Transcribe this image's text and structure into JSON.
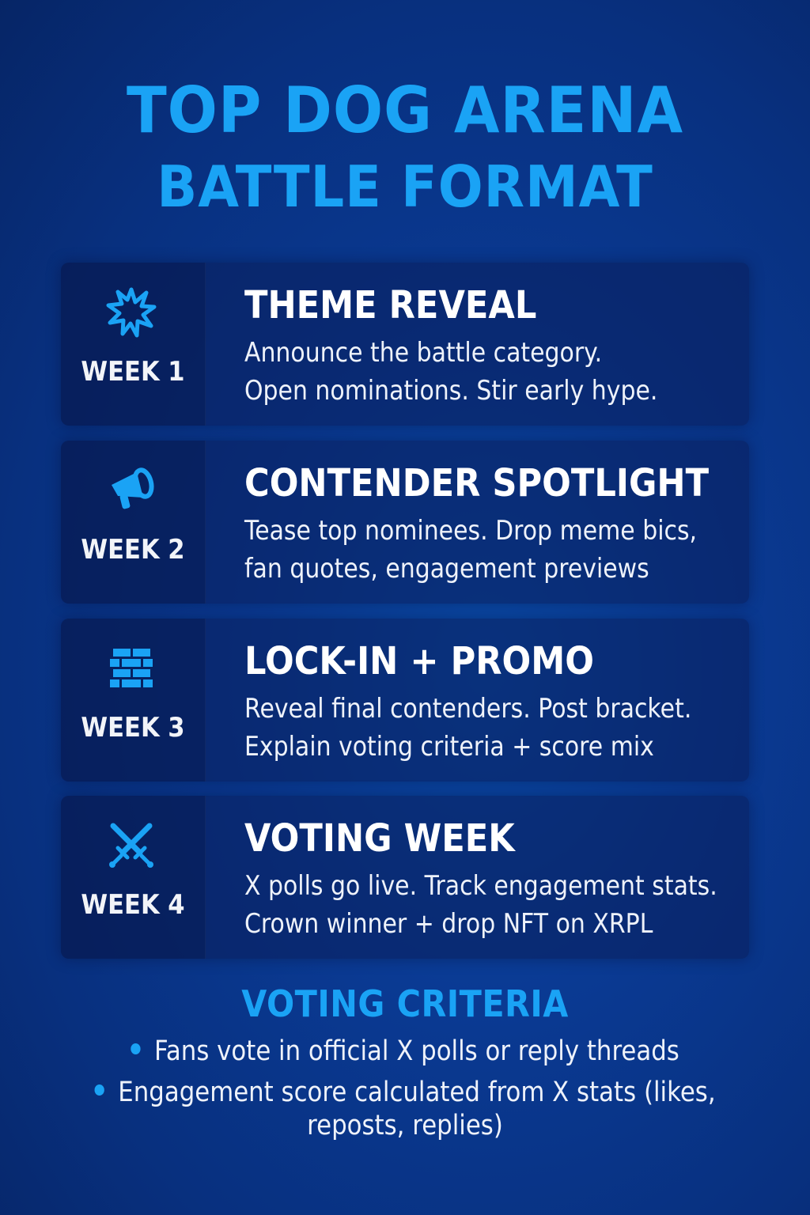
{
  "header": {
    "title_line1": "TOP DOG ARENA",
    "title_line2": "BATTLE FORMAT"
  },
  "weeks": [
    {
      "icon": "burst-icon",
      "week": "WEEK 1",
      "heading": "THEME REVEAL",
      "desc_line1": "Announce the battle category.",
      "desc_line2": "Open nominations. Stir early hype."
    },
    {
      "icon": "megaphone-icon",
      "week": "WEEK 2",
      "heading": "CONTENDER SPOTLIGHT",
      "desc_line1": "Tease top nominees. Drop meme bics,",
      "desc_line2": "fan quotes, engagement previews"
    },
    {
      "icon": "brick-wall-icon",
      "week": "WEEK 3",
      "heading": "LOCK-IN + PROMO",
      "desc_line1": "Reveal final contenders. Post bracket.",
      "desc_line2": "Explain voting criteria + score mix"
    },
    {
      "icon": "crossed-swords-icon",
      "week": "WEEK 4",
      "heading": "VOTING WEEK",
      "desc_line1": "X polls go live. Track engagement stats.",
      "desc_line2": "Crown winner + drop NFT on XRPL"
    }
  ],
  "criteria": {
    "title": "VOTING CRITERIA",
    "items": [
      "Fans vote in official X polls or reply threads",
      "Engagement score calculated from X stats (likes,",
      "reposts, replies)"
    ]
  },
  "colors": {
    "accent": "#1aa3f5",
    "background": "#0a3a93",
    "card": "#0c2a78",
    "text": "#ffffff"
  }
}
